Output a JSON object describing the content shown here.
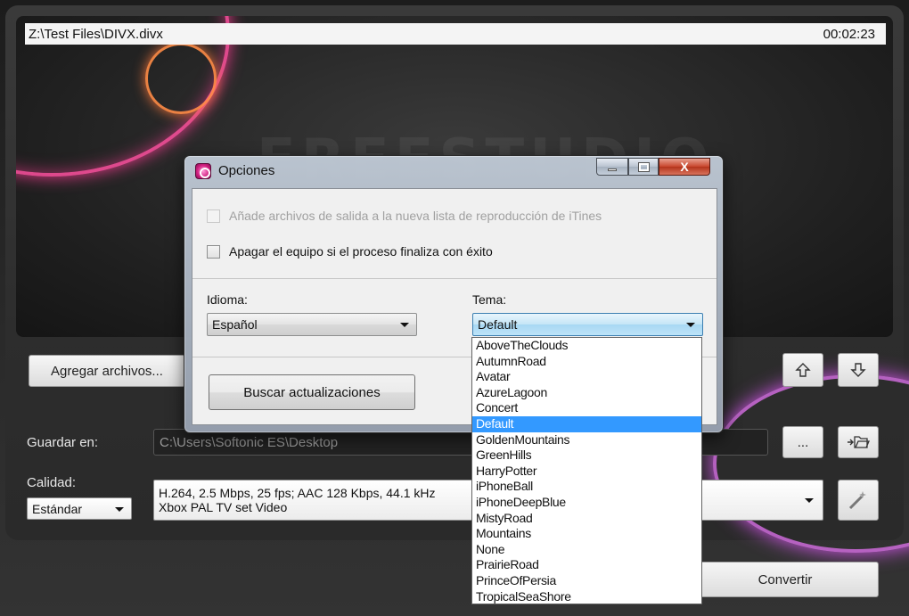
{
  "player": {
    "file_path": "Z:\\Test Files\\DIVX.divx",
    "duration": "00:02:23",
    "watermark": "FREESTUDIO"
  },
  "main": {
    "add_files_label": "Agregar archivos...",
    "save_in_label": "Guardar en:",
    "save_path": "C:\\Users\\Softonic ES\\Desktop",
    "browse_label": "...",
    "quality_label": "Calidad:",
    "quality_value": "Estándar",
    "profile_line1": "H.264, 2.5 Mbps, 25 fps; AAC 128 Kbps, 44.1 kHz",
    "profile_line2": "Xbox PAL TV set Video",
    "convert_label": "Convertir",
    "up_icon": "arrow-up-icon",
    "down_icon": "arrow-down-icon",
    "open_folder_icon": "open-folder-icon",
    "wizard_icon": "magic-wand-icon"
  },
  "dialog": {
    "title": "Opciones",
    "itunes_checkbox": "Añade archivos de salida a la nueva lista de reproducción de iTines",
    "shutdown_checkbox": "Apagar el equipo si el proceso finaliza con éxito",
    "language_label": "Idioma:",
    "language_value": "Español",
    "theme_label": "Tema:",
    "theme_value": "Default",
    "check_updates_label": "Buscar actualizaciones",
    "minimize_label": "",
    "maximize_label": "",
    "close_label": "X"
  },
  "theme_options": [
    "AboveTheClouds",
    "AutumnRoad",
    "Avatar",
    "AzureLagoon",
    "Concert",
    "Default",
    "GoldenMountains",
    "GreenHills",
    "HarryPotter",
    "iPhoneBall",
    "iPhoneDeepBlue",
    "MistyRoad",
    "Mountains",
    "None",
    "PrairieRoad",
    "PrinceOfPersia",
    "TropicalSeaShore"
  ],
  "selected_theme": "Default",
  "colors": {
    "selection": "#3399ff",
    "glow_pink": "#ff50a0",
    "glow_orange": "#ff8c46"
  }
}
